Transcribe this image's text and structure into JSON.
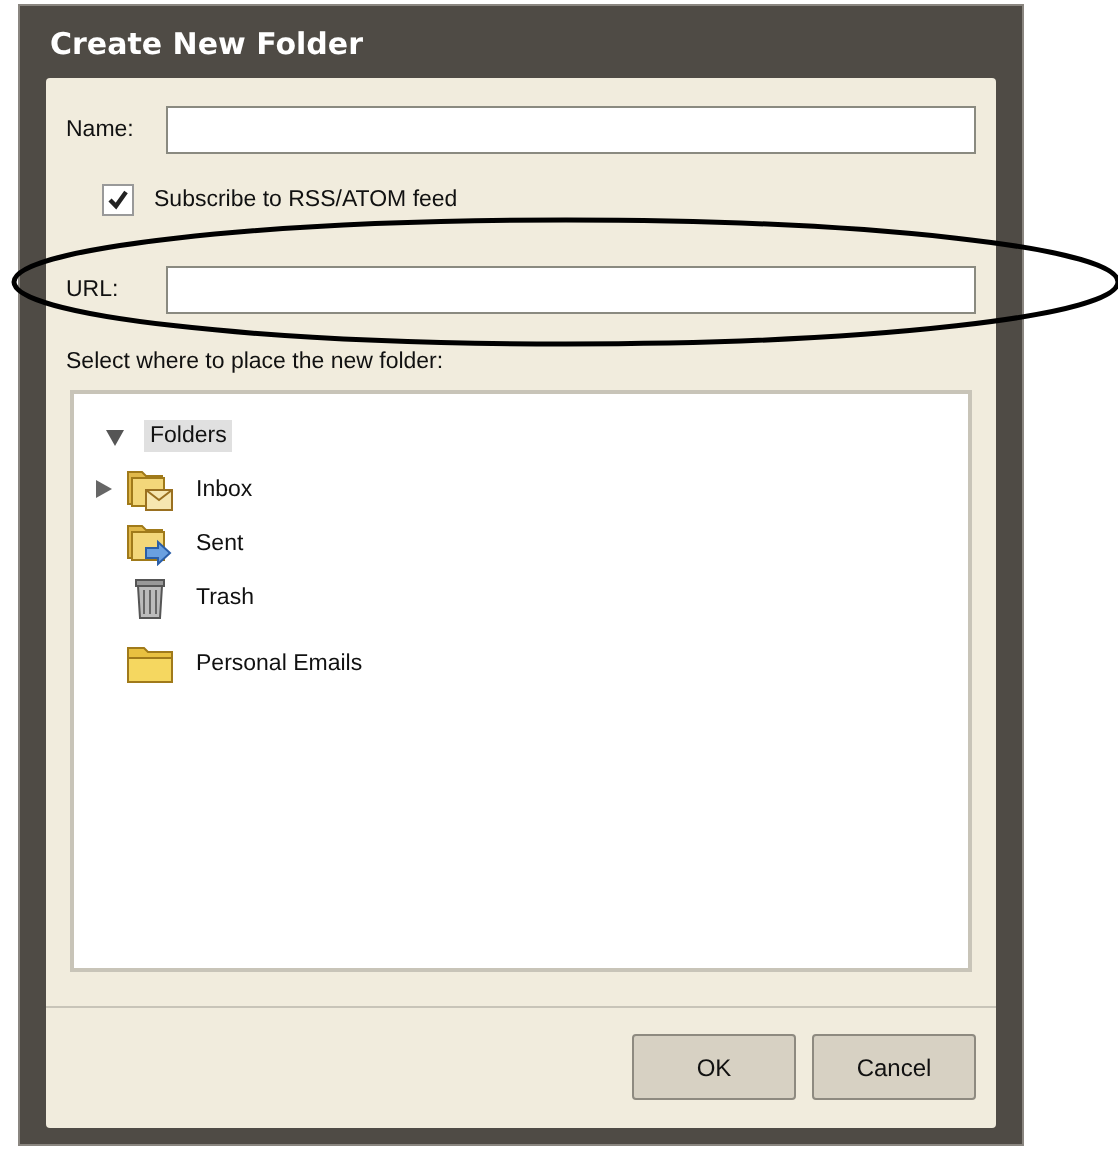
{
  "window": {
    "title": "Create New Folder"
  },
  "name_field": {
    "label": "Name:"
  },
  "subscribe": {
    "label": "Subscribe to RSS/ATOM feed",
    "checked": true
  },
  "url_field": {
    "label": "URL:"
  },
  "location_label": "Select where to place the new folder:",
  "tree": {
    "label": "Folders",
    "expanded": true,
    "selected": true,
    "children": [
      {
        "label": "Inbox",
        "kind": "inbox",
        "has_children": true,
        "selected": false
      },
      {
        "label": "Sent",
        "kind": "sent",
        "has_children": false,
        "selected": false
      },
      {
        "label": "Trash",
        "kind": "trash",
        "has_children": false,
        "selected": false
      },
      {
        "label": "Personal Emails",
        "kind": "folder",
        "has_children": false,
        "selected": false
      }
    ]
  },
  "buttons": [
    "OK",
    "Cancel"
  ]
}
